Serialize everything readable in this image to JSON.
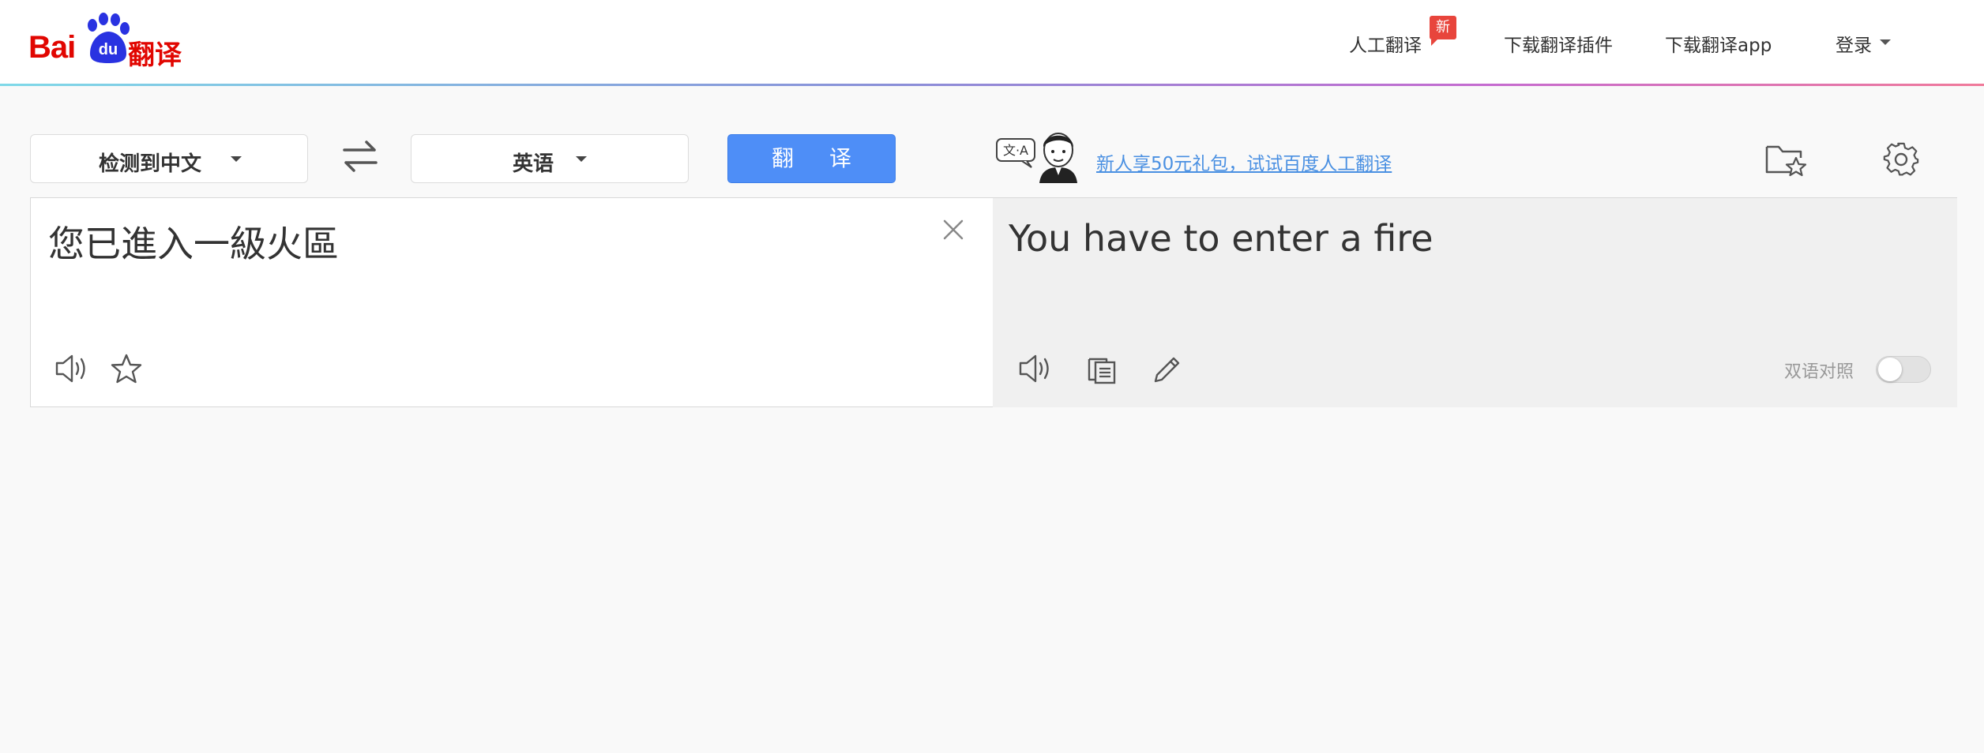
{
  "header": {
    "logo": {
      "latin": "Bai",
      "paw_text": "du",
      "chinese": "翻译"
    },
    "nav": {
      "human_translation": "人工翻译",
      "new_badge": "新",
      "download_plugin": "下载翻译插件",
      "download_app": "下载翻译app",
      "login": "登录"
    }
  },
  "toolbar": {
    "source_language": "检测到中文",
    "target_language": "英语",
    "translate_button": "翻 译",
    "promo_art_text": "文·A",
    "promo_link": "新人享50元礼包，试试百度人工翻译"
  },
  "source_panel": {
    "text": "您已進入一級火區"
  },
  "target_panel": {
    "text": "You have to enter a fire",
    "bilingual_label": "双语对照",
    "bilingual_enabled": false
  },
  "colors": {
    "brand_red": "#e10601",
    "brand_blue": "#2932e1",
    "accent_blue": "#4e8ef7",
    "link_blue": "#4a90e2"
  }
}
